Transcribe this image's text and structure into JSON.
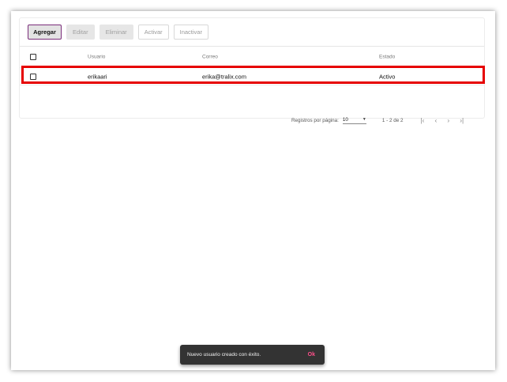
{
  "toolbar": {
    "add_label": "Agregar",
    "edit_label": "Editar",
    "delete_label": "Eliminar",
    "activate_label": "Activar",
    "deactivate_label": "Inactivar"
  },
  "table": {
    "columns": [
      "Usuario",
      "Correo",
      "Estado"
    ],
    "rows": [
      {
        "user": "erikaari",
        "email": "erika@tralix.com",
        "status": "Activo"
      }
    ]
  },
  "paginator": {
    "page_size_label": "Registros por página:",
    "page_size": "10",
    "range": "1 - 2 de 2"
  },
  "snackbar": {
    "message": "Nuevo usuario creado con éxito.",
    "action": "Ok"
  },
  "colors": {
    "accent": "#7b2d7b",
    "highlight": "#e60000",
    "snackbar_bg": "#333333",
    "snackbar_action": "#ff4f8b"
  }
}
